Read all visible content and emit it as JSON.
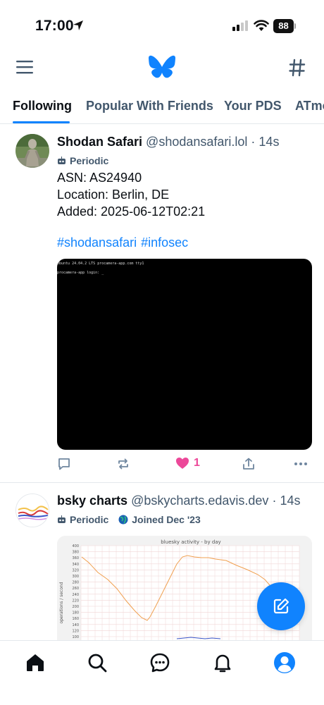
{
  "status_bar": {
    "time": "17:00",
    "battery": "88"
  },
  "header": {
    "icons": [
      "menu-icon",
      "bluesky-logo-icon",
      "hash-icon"
    ]
  },
  "tabs": [
    {
      "label": "Following",
      "active": true
    },
    {
      "label": "Popular With Friends",
      "active": false
    },
    {
      "label": "Your PDS",
      "active": false
    },
    {
      "label": "ATmo",
      "active": false
    }
  ],
  "posts": [
    {
      "display_name": "Shodan Safari",
      "handle": "@shodansafari.lol",
      "time": "· 14s",
      "labels": [
        {
          "icon": "robot-icon",
          "text": "Periodic"
        }
      ],
      "lines": [
        "ASN: AS24940",
        "Location: Berlin, DE",
        "Added: 2025-06-12T02:21"
      ],
      "tags": [
        "#shodansafari",
        "#infosec"
      ],
      "terminal": {
        "line1": "Ubuntu 24.04.2 LTS procamera-app.com tty1",
        "line2": "procamera-app login: _"
      },
      "actions": {
        "like_count": "1"
      }
    },
    {
      "display_name": "bsky charts",
      "handle": "@bskycharts.edavis.dev",
      "time": "· 14s",
      "labels": [
        {
          "icon": "robot-icon",
          "text": "Periodic"
        },
        {
          "icon": "globe-icon",
          "text": "Joined Dec '23"
        }
      ],
      "chart": {
        "title": "bluesky activity - by day",
        "ylabel": "operations / second",
        "y_ticks": [
          "400",
          "380",
          "360",
          "340",
          "320",
          "300",
          "280",
          "260",
          "240",
          "220",
          "200",
          "180",
          "160",
          "140",
          "120",
          "100",
          "80"
        ]
      }
    }
  ],
  "colors": {
    "accent": "#1083fe",
    "like": "#ec4899",
    "muted": "#42576c"
  }
}
